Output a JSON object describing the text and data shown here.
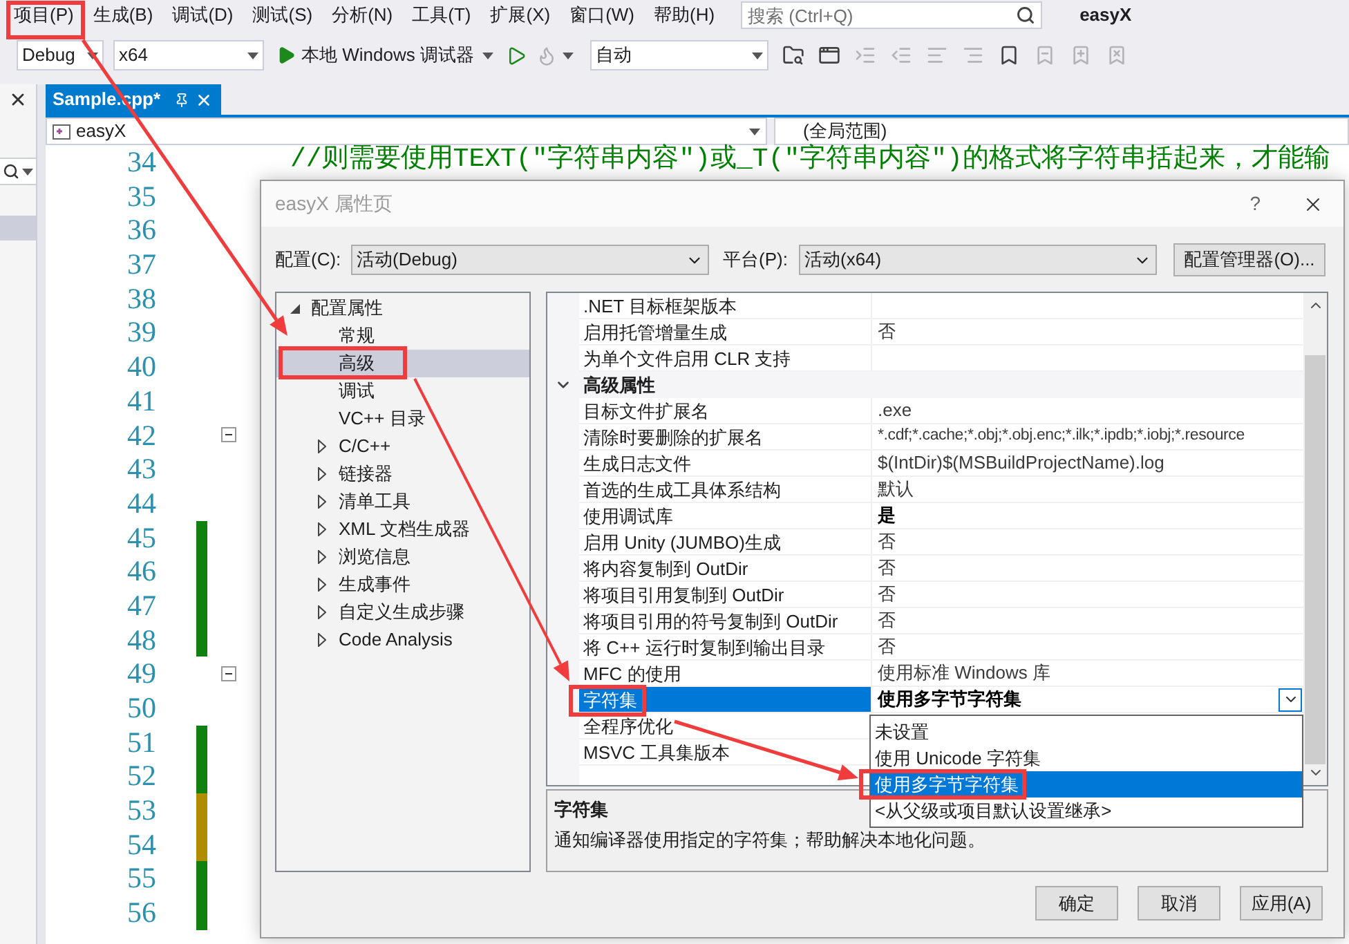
{
  "menu": {
    "items": [
      "项目(P)",
      "生成(B)",
      "调试(D)",
      "测试(S)",
      "分析(N)",
      "工具(T)",
      "扩展(X)",
      "窗口(W)",
      "帮助(H)"
    ],
    "search": {
      "placeholder": "搜索 (Ctrl+Q)"
    },
    "solution_name": "easyX"
  },
  "toolbar": {
    "configuration": "Debug",
    "platform": "x64",
    "debugger": "本地 Windows 调试器",
    "stack_frame": "自动",
    "icon_buttons": [
      {
        "kind": "open-folder",
        "disabled": false
      },
      {
        "kind": "window",
        "disabled": false
      },
      {
        "kind": "indent",
        "disabled": true
      },
      {
        "kind": "outdent",
        "disabled": true
      },
      {
        "kind": "align-left",
        "disabled": true
      },
      {
        "kind": "align-right",
        "disabled": true
      },
      {
        "kind": "bookmark",
        "disabled": false
      },
      {
        "kind": "bookmark-minus",
        "disabled": true
      },
      {
        "kind": "bookmark-plus",
        "disabled": true
      },
      {
        "kind": "bookmark-x",
        "disabled": true
      }
    ]
  },
  "editor_tab": {
    "title": "Sample.cpp*",
    "selected": true
  },
  "navigation": {
    "project": "easyX",
    "scope": "(全局范围)"
  },
  "lines": [
    {
      "number": "34",
      "fold": false,
      "code": "//则需要使用TEXT(\"字符串内容\")或_T(\"字符串内容\")的格式将字符串括起来，才能输"
    },
    {
      "number": "35",
      "fold": false
    },
    {
      "number": "36",
      "fold": false
    },
    {
      "number": "37",
      "fold": false
    },
    {
      "number": "38",
      "fold": false
    },
    {
      "number": "39",
      "fold": false
    },
    {
      "number": "40",
      "fold": false
    },
    {
      "number": "41",
      "fold": false
    },
    {
      "number": "42",
      "fold": true
    },
    {
      "number": "43",
      "fold": false
    },
    {
      "number": "44",
      "fold": false
    },
    {
      "number": "45",
      "fold": false,
      "color": "#108010"
    },
    {
      "number": "46",
      "fold": false,
      "color": "#108010"
    },
    {
      "number": "47",
      "fold": false,
      "color": "#108010"
    },
    {
      "number": "48",
      "fold": false,
      "color": "#108010"
    },
    {
      "number": "49",
      "fold": true
    },
    {
      "number": "50",
      "fold": false
    },
    {
      "number": "51",
      "fold": false,
      "color": "#108010"
    },
    {
      "number": "52",
      "fold": false,
      "color": "#108010"
    },
    {
      "number": "53",
      "fold": false,
      "color": "#b08c00"
    },
    {
      "number": "54",
      "fold": false,
      "color": "#b08c00"
    },
    {
      "number": "55",
      "fold": false,
      "color": "#108010"
    },
    {
      "number": "56",
      "fold": false,
      "color": "#108010"
    }
  ],
  "dialog": {
    "title": "easyX 属性页",
    "help": "?",
    "configuration_label": "配置(C):",
    "configuration": "活动(Debug)",
    "platform_label": "平台(P):",
    "platform": "活动(x64)",
    "manager_button": "配置管理器(O)...",
    "tree": [
      {
        "label": "配置属性",
        "expanded": true,
        "selected": false,
        "children": [
          {
            "label": "常规",
            "selected": false
          },
          {
            "label": "高级",
            "selected": true
          },
          {
            "label": "调试",
            "selected": false
          },
          {
            "label": "VC++ 目录",
            "selected": false
          },
          {
            "label": "C/C++",
            "expanded": false,
            "selected": false
          },
          {
            "label": "链接器",
            "expanded": false,
            "selected": false
          },
          {
            "label": "清单工具",
            "expanded": false,
            "selected": false
          },
          {
            "label": "XML 文档生成器",
            "expanded": false,
            "selected": false
          },
          {
            "label": "浏览信息",
            "expanded": false,
            "selected": false
          },
          {
            "label": "生成事件",
            "expanded": false,
            "selected": false
          },
          {
            "label": "自定义生成步骤",
            "expanded": false,
            "selected": false
          },
          {
            "label": "Code Analysis",
            "expanded": false,
            "selected": false
          }
        ]
      }
    ],
    "grid_rows": [
      {
        "kind": "property",
        "name": ".NET 目标框架版本",
        "selected": false
      },
      {
        "kind": "property",
        "name": "启用托管增量生成",
        "value": "否",
        "modified": false,
        "selected": false
      },
      {
        "kind": "property",
        "name": "为单个文件启用 CLR 支持",
        "selected": false
      },
      {
        "kind": "section",
        "label": "高级属性",
        "expanded": true
      },
      {
        "kind": "property",
        "name": "目标文件扩展名",
        "value": ".exe",
        "modified": false,
        "selected": false
      },
      {
        "kind": "property",
        "name": "清除时要删除的扩展名",
        "value": "*.cdf;*.cache;*.obj;*.obj.enc;*.ilk;*.ipdb;*.iobj;*.resource",
        "modified": false,
        "selected": false
      },
      {
        "kind": "property",
        "name": "生成日志文件",
        "value": "$(IntDir)$(MSBuildProjectName).log",
        "modified": false,
        "selected": false
      },
      {
        "kind": "property",
        "name": "首选的生成工具体系结构",
        "value": "默认",
        "modified": false,
        "selected": false
      },
      {
        "kind": "property",
        "name": "使用调试库",
        "value": "是",
        "modified": true,
        "selected": false
      },
      {
        "kind": "property",
        "name": "启用 Unity (JUMBO)生成",
        "value": "否",
        "modified": false,
        "selected": false
      },
      {
        "kind": "property",
        "name": "将内容复制到 OutDir",
        "value": "否",
        "modified": false,
        "selected": false
      },
      {
        "kind": "property",
        "name": "将项目引用复制到 OutDir",
        "value": "否",
        "modified": false,
        "selected": false
      },
      {
        "kind": "property",
        "name": "将项目引用的符号复制到 OutDir",
        "value": "否",
        "modified": false,
        "selected": false
      },
      {
        "kind": "property",
        "name": "将 C++ 运行时复制到输出目录",
        "value": "否",
        "modified": false,
        "selected": false
      },
      {
        "kind": "property",
        "name": "MFC 的使用",
        "value": "使用标准 Windows 库",
        "modified": false,
        "selected": false
      },
      {
        "kind": "property",
        "name": "字符集",
        "value": "使用多字节字符集",
        "modified": true,
        "selected": true,
        "options": [
          {
            "label": "未设置",
            "selected": false
          },
          {
            "label": "使用 Unicode 字符集",
            "selected": false
          },
          {
            "label": "使用多字节字符集",
            "selected": true
          },
          {
            "label": "<从父级或项目默认设置继承>",
            "selected": false
          }
        ]
      },
      {
        "kind": "property",
        "name": "全程序优化",
        "selected": false
      },
      {
        "kind": "property",
        "name": "MSVC 工具集版本",
        "selected": false
      }
    ],
    "description": {
      "title": "字符集",
      "text": "通知编译器使用指定的字符集；帮助解决本地化问题。"
    },
    "buttons": [
      "确定",
      "取消",
      "应用(A)"
    ]
  }
}
